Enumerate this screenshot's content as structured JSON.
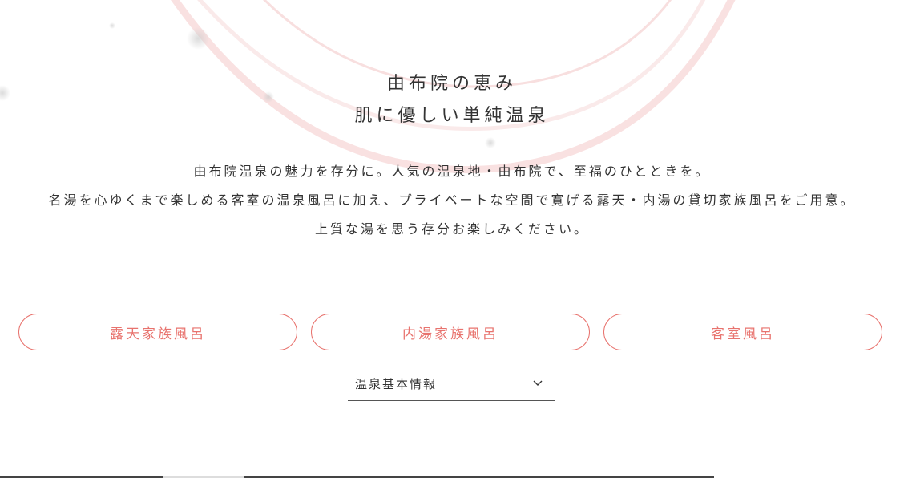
{
  "heading": {
    "line1": "由布院の恵み",
    "line2": "肌に優しい単純温泉"
  },
  "description": {
    "line1": "由布院温泉の魅力を存分に。人気の温泉地・由布院で、至福のひとときを。",
    "line2": "名湯を心ゆくまで楽しめる客室の温泉風呂に加え、プライベートな空間で寛げる露天・内湯の貸切家族風呂をご用意。",
    "line3": "上質な湯を思う存分お楽しみください。"
  },
  "buttons": [
    {
      "label": "露天家族風呂"
    },
    {
      "label": "内湯家族風呂"
    },
    {
      "label": "客室風呂"
    }
  ],
  "dropdown": {
    "label": "温泉基本情報",
    "icon": "chevron-down-icon"
  },
  "colors": {
    "accent": "#e8736e",
    "text": "#333333",
    "background": "#ffffff"
  }
}
